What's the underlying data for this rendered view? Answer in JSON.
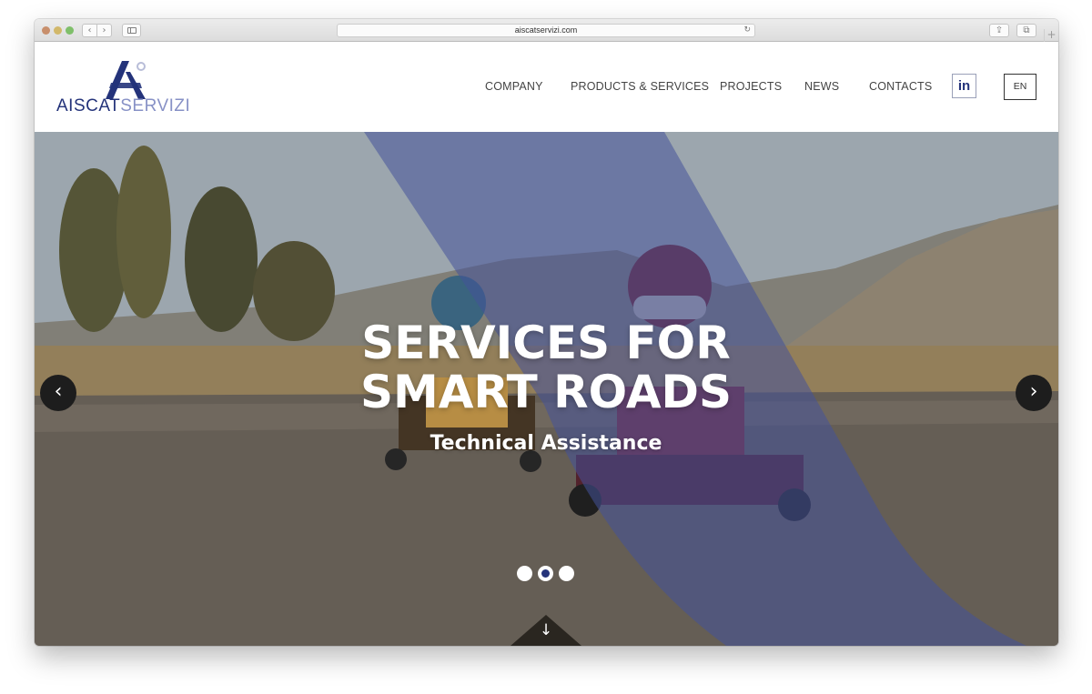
{
  "browser": {
    "url": "aiscatservizi.com",
    "back_icon": "‹",
    "forward_icon": "›",
    "reload_icon": "↻",
    "share_icon": "⇪",
    "tabs_icon": "⧉",
    "newtab_icon": "+"
  },
  "header": {
    "logo_part1": "AISCAT",
    "logo_part2": "SERVIZI",
    "nav": [
      {
        "label": "COMPANY"
      },
      {
        "label": "PRODUCTS & SERVICES"
      },
      {
        "label": "PROJECTS"
      },
      {
        "label": "NEWS"
      },
      {
        "label": "CONTACTS"
      }
    ],
    "linkedin_label": "in",
    "language": "EN"
  },
  "hero": {
    "title": "SERVICES FOR SMART ROADS",
    "subtitle": "Technical Assistance",
    "prev_icon": "‹",
    "next_icon": "›",
    "scroll_icon": "↓",
    "slides": 3,
    "active_slide": 2
  },
  "colors": {
    "brand_dark": "#24337a",
    "brand_light": "#8791c6",
    "overlay": "#4a5aa8"
  }
}
